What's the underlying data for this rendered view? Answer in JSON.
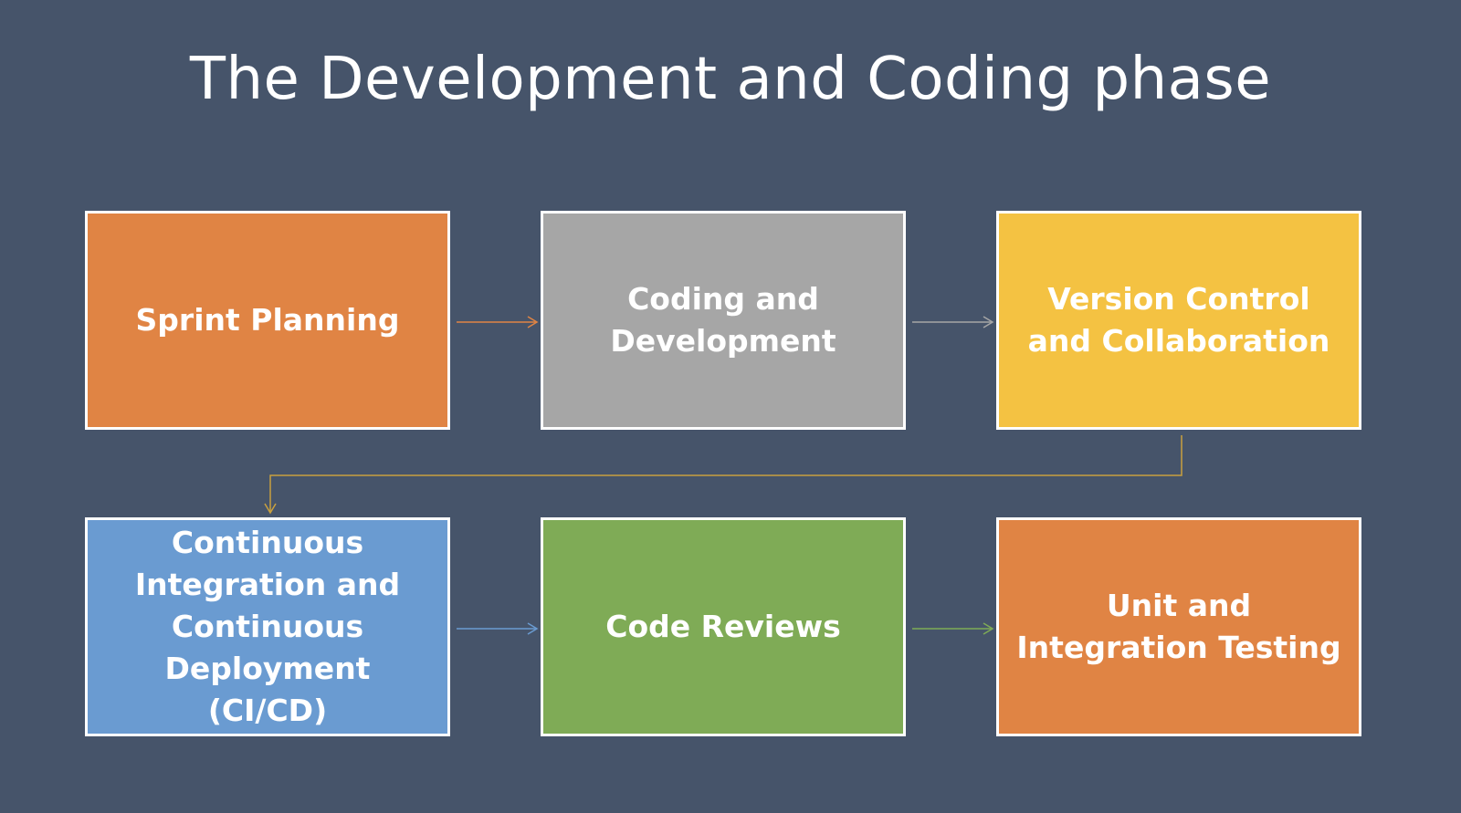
{
  "title": "The Development and Coding phase",
  "steps": [
    {
      "label": "Sprint Planning",
      "color": "#e08444"
    },
    {
      "label": "Coding and Development",
      "color": "#a6a6a6"
    },
    {
      "label": "Version Control and Collaboration",
      "color": "#f4c242"
    },
    {
      "label": "Continuous Integration and Continuous Deployment (CI/CD)",
      "color": "#6a9bd1"
    },
    {
      "label": "Code Reviews",
      "color": "#7fab56"
    },
    {
      "label": "Unit and Integration Testing",
      "color": "#e08444"
    }
  ],
  "background": "#46546a"
}
